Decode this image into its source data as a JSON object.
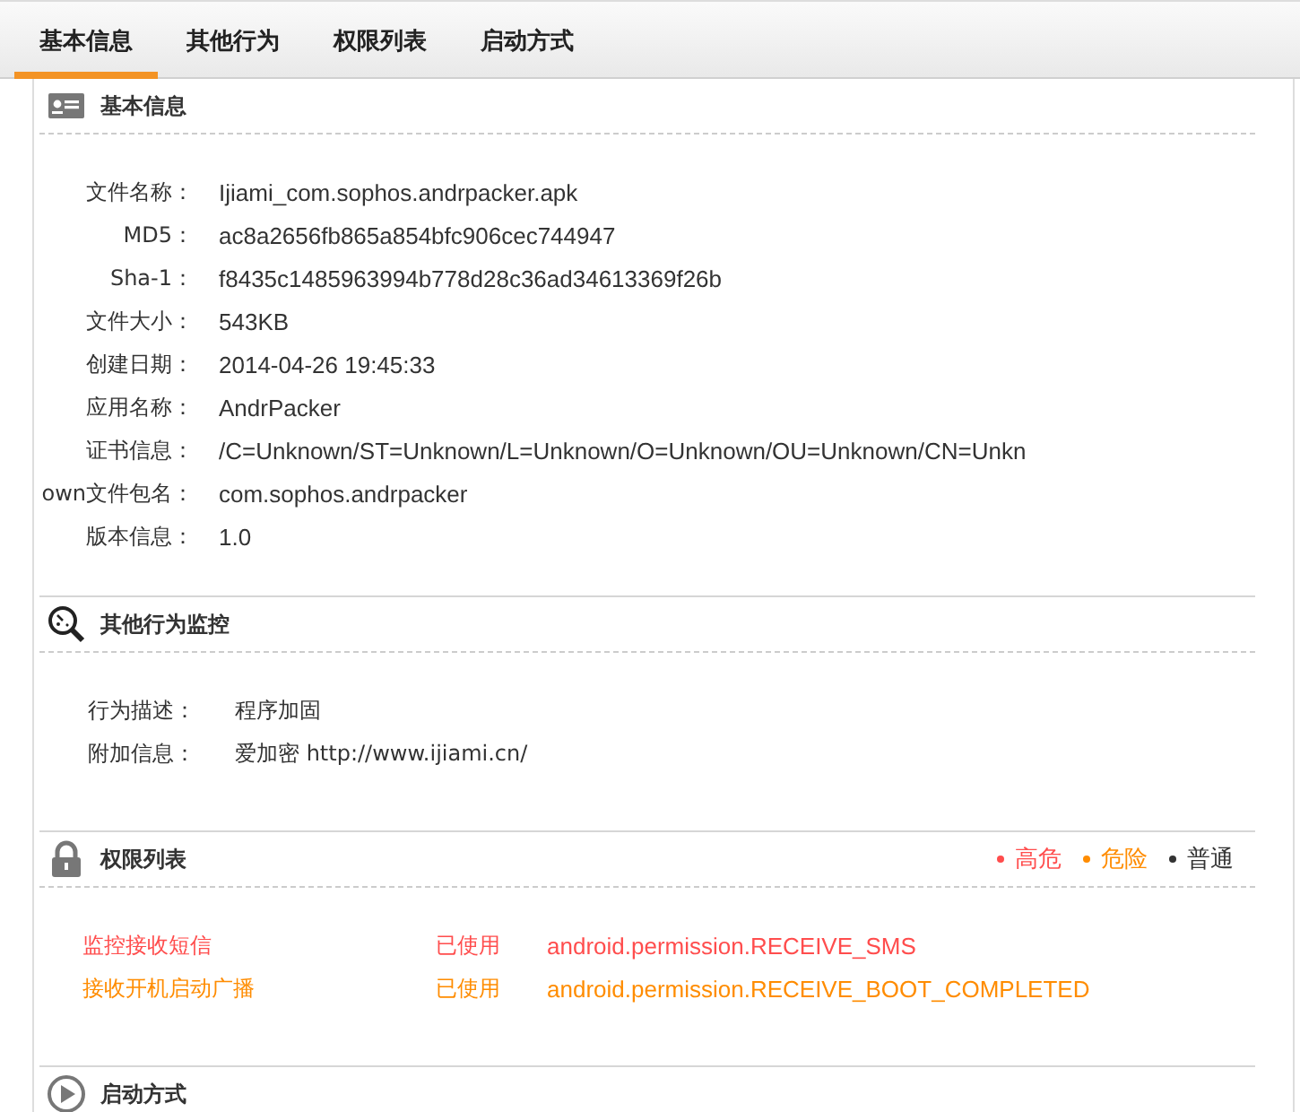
{
  "tabs": [
    {
      "label": "基本信息",
      "selected": true
    },
    {
      "label": "其他行为",
      "selected": false
    },
    {
      "label": "权限列表",
      "selected": false
    },
    {
      "label": "启动方式",
      "selected": false
    }
  ],
  "basic_info": {
    "title": "基本信息",
    "rows": [
      {
        "label": "文件名称：",
        "value": "Ijiami_com.sophos.andrpacker.apk"
      },
      {
        "label": "MD5：",
        "value": "ac8a2656fb865a854bfc906cec744947"
      },
      {
        "label": "Sha-1：",
        "value": "f8435c1485963994b778d28c36ad34613369f26b"
      },
      {
        "label": "文件大小：",
        "value": "543KB"
      },
      {
        "label": "创建日期：",
        "value": "2014-04-26 19:45:33"
      },
      {
        "label": "应用名称：",
        "value": "AndrPacker"
      },
      {
        "label": "证书信息：",
        "value": "/C=Unknown/ST=Unknown/L=Unknown/O=Unknown/OU=Unknown/CN=Unkn"
      },
      {
        "label": "own文件包名：",
        "value": "com.sophos.andrpacker"
      },
      {
        "label": "版本信息：",
        "value": "1.0"
      }
    ]
  },
  "other_behavior": {
    "title": "其他行为监控",
    "rows": [
      {
        "label": "行为描述：",
        "value": "程序加固"
      },
      {
        "label": "附加信息：",
        "value": "爱加密 http://www.ijiami.cn/"
      }
    ]
  },
  "permissions": {
    "title": "权限列表",
    "legend": [
      {
        "label": "高危",
        "color": "#ff4d4d"
      },
      {
        "label": "危险",
        "color": "#ff8c00"
      },
      {
        "label": "普通",
        "color": "#333333"
      }
    ],
    "rows": [
      {
        "name": "监控接收短信",
        "status": "已使用",
        "permission": "android.permission.RECEIVE_SMS",
        "color": "#ff4d4d"
      },
      {
        "name": "接收开机启动广播",
        "status": "已使用",
        "permission": "android.permission.RECEIVE_BOOT_COMPLETED",
        "color": "#ff8c00"
      }
    ]
  },
  "startup": {
    "title": "启动方式"
  }
}
